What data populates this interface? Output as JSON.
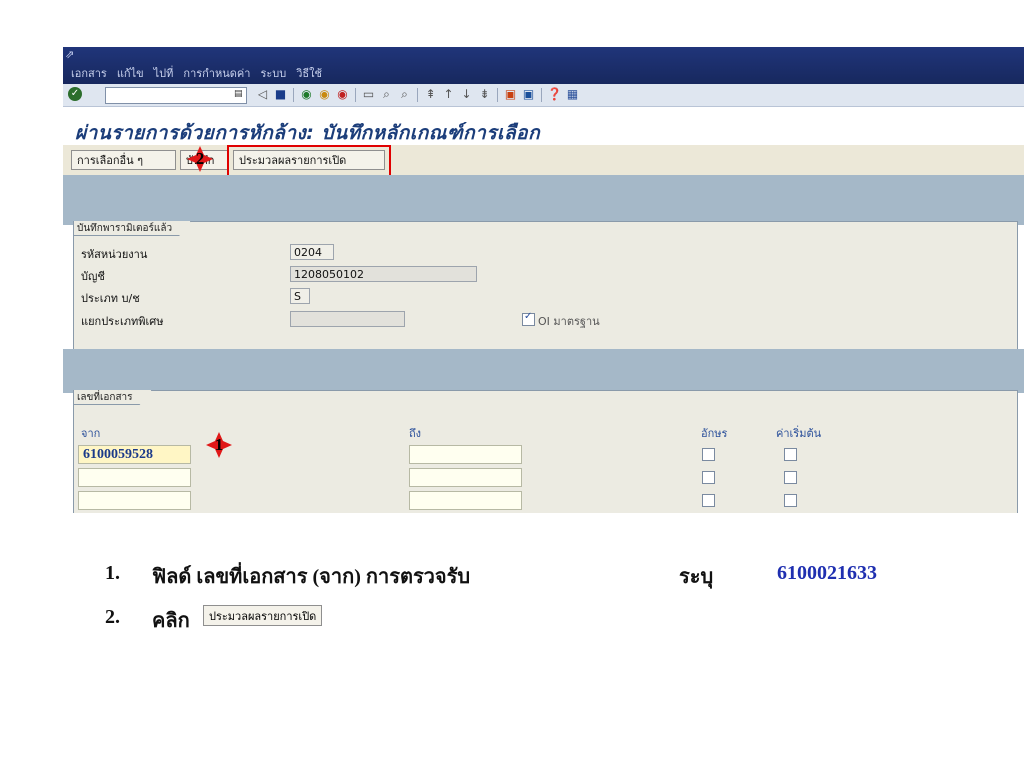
{
  "menu": [
    "เอกสาร",
    "แก้ไข",
    "ไปที่",
    "การกำหนดค่า",
    "ระบบ",
    "วิธีใช้"
  ],
  "title": "ผ่านรายการด้วยการหักล้าง: บันทึกหลักเกณฑ์การเลือก",
  "app_toolbar": {
    "other_selection": "การเลือกอื่น ๆ",
    "edit_partial": "บันทึกย่อ",
    "process_open_items": "ประมวลผลรายการเปิด"
  },
  "markers": {
    "one": "1",
    "two": "2"
  },
  "params_group": {
    "title": "บันทึกพารามิเตอร์แล้ว",
    "company_code_label": "รหัสหน่วยงาน",
    "company_code_value": "0204",
    "account_label": "บัญชี",
    "account_value": "1208050102",
    "account_type_label": "ประเภท บ/ช",
    "account_type_value": "S",
    "special_gl_label": "แยกประเภทพิเศษ",
    "special_gl_value": "",
    "standard_oi_label": "OI มาตรฐาน",
    "standard_oi_checked": true
  },
  "doc_group": {
    "title": "เลขที่เอกสาร",
    "from_label": "จาก",
    "to_label": "ถึง",
    "char_label": "อักษร",
    "initial_label": "ค่าเริ่มต้น",
    "rows": [
      {
        "from": "6100059528",
        "to": ""
      },
      {
        "from": "",
        "to": ""
      },
      {
        "from": "",
        "to": ""
      }
    ]
  },
  "instructions": [
    {
      "num": "1.",
      "text": "ฟิลด์ เลขที่เอกสาร (จาก) การตรวจรับ",
      "action": "ระบุ",
      "value": "6100021633"
    },
    {
      "num": "2.",
      "text": "คลิก",
      "button": "ประมวลผลรายการเปิด"
    }
  ]
}
